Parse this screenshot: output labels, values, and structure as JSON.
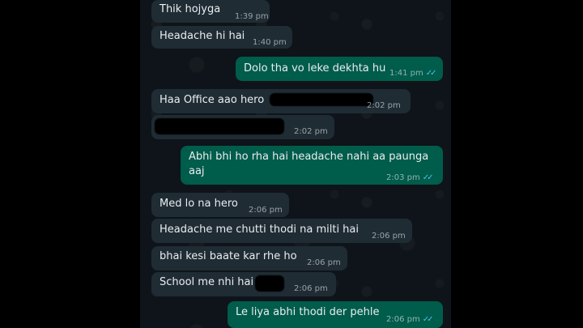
{
  "messages": [
    {
      "dir": "in",
      "text": "Thik hojyga",
      "time": "1:39 pm"
    },
    {
      "dir": "in",
      "text": "Headache hi hai",
      "time": "1:40 pm"
    },
    {
      "dir": "out",
      "text": "Dolo tha vo leke dekhta hu",
      "time": "1:41 pm",
      "status": "read"
    },
    {
      "dir": "in",
      "text": "Haa Office aao hero",
      "time": "2:02 pm",
      "redacted": true
    },
    {
      "dir": "in",
      "text": "",
      "time": "2:02 pm",
      "redacted": true
    },
    {
      "dir": "out",
      "text": "Abhi bhi ho rha hai headache nahi aa paunga",
      "text2": "aaj",
      "time": "2:03 pm",
      "status": "read"
    },
    {
      "dir": "in",
      "text": "Med lo na hero",
      "time": "2:06 pm"
    },
    {
      "dir": "in",
      "text": "Headache me chutti thodi na milti hai",
      "time": "2:06 pm"
    },
    {
      "dir": "in",
      "text": "bhai kesi baate kar rhe ho",
      "time": "2:06 pm"
    },
    {
      "dir": "in",
      "text": "School me nhi hai",
      "time": "2:06 pm",
      "redacted": true
    },
    {
      "dir": "out",
      "text": "Le liya abhi thodi der pehle",
      "time": "2:06 pm",
      "status": "read"
    }
  ],
  "colors": {
    "incoming": "#1f2c34",
    "outgoing": "#005c4b",
    "read_ticks": "#53bdeb",
    "chat_bg": "#0e1419"
  },
  "icons": {
    "read_receipt": "double-check-icon"
  }
}
